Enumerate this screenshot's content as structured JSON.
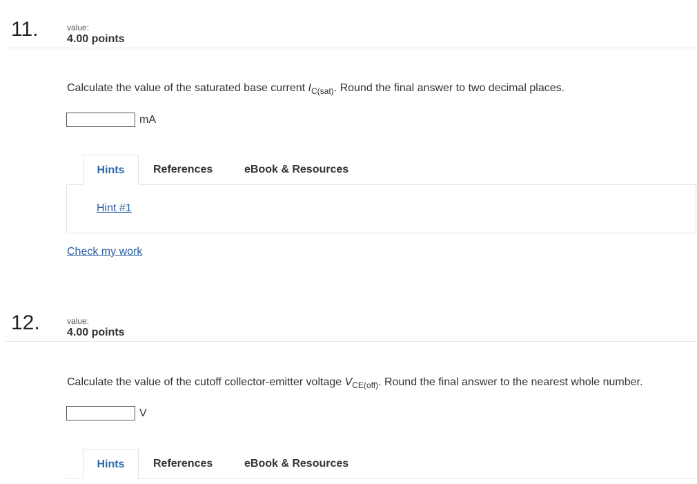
{
  "questions": [
    {
      "number": "11.",
      "value_label": "value:",
      "points": "4.00 points",
      "prompt_pre": "Calculate the value of  the saturated base current ",
      "var_main": "I",
      "var_sub": "C(sat)",
      "prompt_post": ". Round the final answer to two decimal places.",
      "answer_value": "",
      "unit": "mA",
      "tabs": [
        {
          "label": "Hints",
          "active": true
        },
        {
          "label": "References",
          "active": false
        },
        {
          "label": "eBook & Resources",
          "active": false
        }
      ],
      "hint_link": "Hint #1",
      "check_link": "Check my work"
    },
    {
      "number": "12.",
      "value_label": "value:",
      "points": "4.00 points",
      "prompt_pre": "Calculate the value of  the cutoff collector-emitter voltage ",
      "var_main": "V",
      "var_sub": "CE(off)",
      "prompt_post": ". Round the final answer to the nearest whole number.",
      "answer_value": "",
      "unit": "V",
      "tabs": [
        {
          "label": "Hints",
          "active": true
        },
        {
          "label": "References",
          "active": false
        },
        {
          "label": "eBook & Resources",
          "active": false
        }
      ]
    }
  ]
}
